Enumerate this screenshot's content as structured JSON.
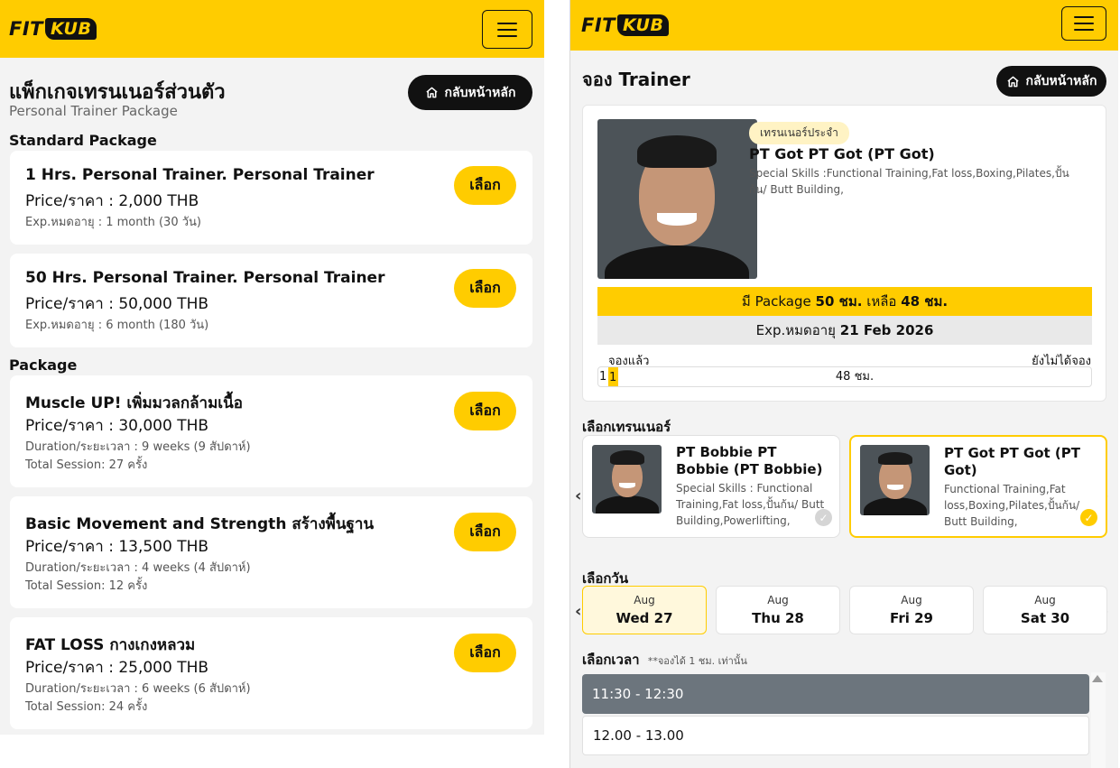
{
  "brand": {
    "logo_fit": "FIT",
    "logo_kub": "KUB"
  },
  "screen1": {
    "title": "แพ็กเกจเทรนเนอร์ส่วนตัว",
    "subtitle": "Personal Trainer Package",
    "home_label": "กลับหน้าหลัก",
    "sections": {
      "standard": "Standard Package",
      "package": "Package"
    },
    "select_label": "เลือก",
    "packages": [
      {
        "name": "1 Hrs. Personal Trainer. Personal Trainer",
        "price": "Price/ราคา : 2,000 THB",
        "exp": "Exp.หมดอายุ : 1 month (30 วัน)"
      },
      {
        "name": "50 Hrs. Personal Trainer. Personal Trainer",
        "price": "Price/ราคา : 50,000 THB",
        "exp": "Exp.หมดอายุ : 6 month (180 วัน)"
      },
      {
        "name": "Muscle UP! เพิ่มมวลกล้ามเนื้อ",
        "price": "Price/ราคา : 30,000 THB",
        "duration": "Duration/ระยะเวลา : 9 weeks (9 สัปดาห์)",
        "sessions": "Total Session: 27 ครั้ง"
      },
      {
        "name": "Basic Movement and Strength สร้างพื้นฐาน",
        "price": "Price/ราคา : 13,500 THB",
        "duration": "Duration/ระยะเวลา : 4 weeks (4 สัปดาห์)",
        "sessions": "Total Session: 12 ครั้ง"
      },
      {
        "name": "FAT LOSS กางเกงหลวม",
        "price": "Price/ราคา : 25,000 THB",
        "duration": "Duration/ระยะเวลา : 6 weeks (6 สัปดาห์)",
        "sessions": "Total Session: 24 ครั้ง"
      }
    ]
  },
  "screen2": {
    "title": "จอง Trainer",
    "home_label": "กลับหน้าหลัก",
    "trainer": {
      "badge": "เทรนเนอร์ประจำ",
      "name": "PT Got PT Got (PT Got)",
      "skills": "Special Skills :Functional Training,Fat loss,Boxing,Pilates,ปั้นก้น/ Butt Building,"
    },
    "package_line": {
      "prefix": "มี Package ",
      "total": "50 ชม.",
      "mid": " เหลือ ",
      "left": "48 ชม."
    },
    "exp_line": {
      "prefix": "Exp.หมดอายุ ",
      "date": "21 Feb 2026"
    },
    "progress": {
      "booked_label": "จองแล้ว",
      "not_booked_label": "ยังไม่ได้จอง",
      "booked_value": "1",
      "booked_inner": "1",
      "remaining": "48 ชม.",
      "booked_fraction": 0.02
    },
    "choose_trainer_label": "เลือกเทรนเนอร์",
    "trainers": [
      {
        "name": "PT Bobbie PT Bobbie (PT Bobbie)",
        "skills": "Special Skills : Functional Training,Fat loss,ปั้นก้น/ Butt Building,Powerlifting,"
      },
      {
        "name": "PT Got PT Got (PT Got)",
        "skills": "Functional Training,Fat loss,Boxing,Pilates,ปั้นก้น/ Butt Building,"
      }
    ],
    "choose_day_label": "เลือกวัน",
    "days": [
      {
        "month": "Aug",
        "day": "Wed 27"
      },
      {
        "month": "Aug",
        "day": "Thu 28"
      },
      {
        "month": "Aug",
        "day": "Fri 29"
      },
      {
        "month": "Aug",
        "day": "Sat 30"
      }
    ],
    "choose_time_label": "เลือกเวลา",
    "time_note": "**จองได้ 1 ชม. เท่านั้น",
    "times": [
      "11:30 - 12:30",
      "12.00 - 13.00"
    ]
  },
  "colors": {
    "brand_yellow": "#ffcc00",
    "dark": "#111111",
    "selected_slot": "#6c757d"
  },
  "icons": {
    "home": "home-icon",
    "menu": "hamburger-menu-icon",
    "check": "check-circle-icon",
    "chevron_left": "chevron-left-icon",
    "chevron_right": "chevron-right-icon"
  }
}
